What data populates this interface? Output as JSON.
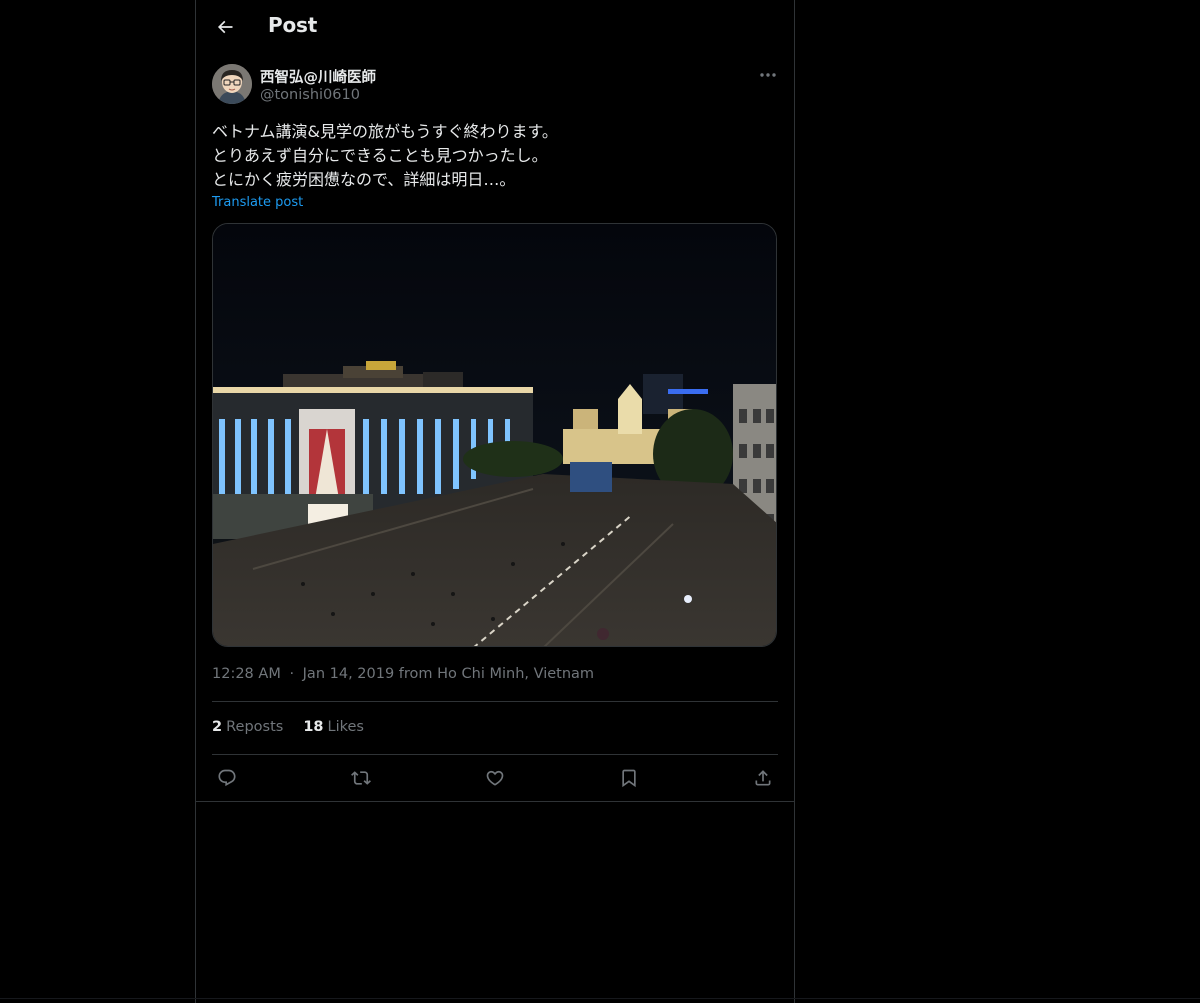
{
  "header": {
    "title": "Post",
    "back_icon": "arrow-left-icon"
  },
  "author": {
    "display_name": "西智弘@川崎医師",
    "handle": "@tonishi0610",
    "more_icon": "more-horizontal-icon"
  },
  "post": {
    "text": "ベトナム講演&見学の旅がもうすぐ終わります。\nとりあえず自分にできることも見つかったし。\nとにかく疲労困憊なので、詳細は明日…。",
    "translate_label": "Translate post",
    "timestamp_time": "12:28 AM",
    "timestamp_sep": "·",
    "timestamp_date": "Jan 14, 2019",
    "location": "from Ho Chi Minh, Vietnam"
  },
  "stats": {
    "reposts_count": "2",
    "reposts_label": "Reposts",
    "likes_count": "18",
    "likes_label": "Likes"
  },
  "actions": [
    {
      "name": "reply",
      "icon": "reply-icon"
    },
    {
      "name": "repost",
      "icon": "repost-icon"
    },
    {
      "name": "like",
      "icon": "heart-icon"
    },
    {
      "name": "bookmark",
      "icon": "bookmark-icon"
    },
    {
      "name": "share",
      "icon": "share-icon"
    }
  ],
  "colors": {
    "background": "#000000",
    "text_primary": "#e7e9ea",
    "text_secondary": "#71767b",
    "link": "#1d9bf0",
    "border": "#2f3336"
  }
}
